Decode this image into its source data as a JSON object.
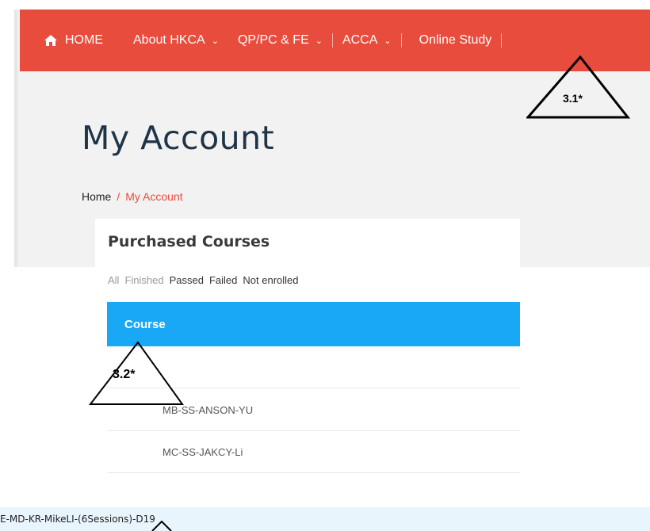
{
  "nav": {
    "home": "HOME",
    "items": [
      {
        "label": "About HKCA",
        "has_dropdown": true
      },
      {
        "label": "QP/PC & FE",
        "has_dropdown": true
      },
      {
        "label": "ACCA",
        "has_dropdown": true
      },
      {
        "label": "Online Study",
        "has_dropdown": false
      }
    ],
    "chevron": "⌄",
    "color": "#e84c3d"
  },
  "page": {
    "title": "My Account",
    "breadcrumb": {
      "home": "Home",
      "separator": "/",
      "current": "My Account"
    }
  },
  "courses": {
    "title": "Purchased Courses",
    "filters": [
      "All",
      "Finished",
      "Passed",
      "Failed",
      "Not enrolled"
    ],
    "column_header": "Course",
    "header_color": "#19a8f5",
    "rows": [
      "MB-SS-ANSON-YU",
      "MC-SS-JAKCY-Li"
    ]
  },
  "bottom_strip": {
    "text": "E-MD-KR-MikeLI-(6Sessions)-D19"
  },
  "annotations": {
    "a1": "3.1*",
    "a2": "3.2*"
  }
}
